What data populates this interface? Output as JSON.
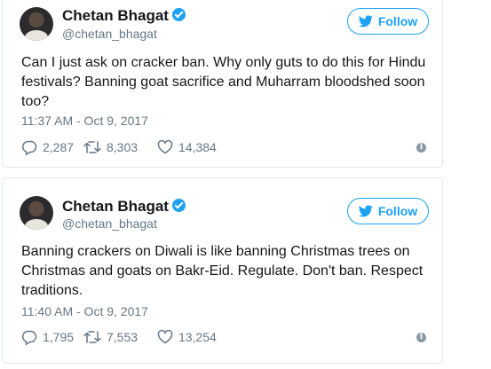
{
  "tweets": [
    {
      "author_name": "Chetan Bhagat",
      "handle": "@chetan_bhagat",
      "verified": true,
      "follow_label": "Follow",
      "text": "Can I just ask on cracker ban. Why only guts to do this for Hindu festivals? Banning goat sacrifice and Muharram bloodshed soon too?",
      "timestamp": "11:37 AM - Oct 9, 2017",
      "replies": "2,287",
      "retweets": "8,303",
      "likes": "14,384"
    },
    {
      "author_name": "Chetan Bhagat",
      "handle": "@chetan_bhagat",
      "verified": true,
      "follow_label": "Follow",
      "text": "Banning crackers on Diwali is like banning Christmas trees on Christmas and goats on Bakr-Eid. Regulate. Don't ban. Respect traditions.",
      "timestamp": "11:40 AM - Oct 9, 2017",
      "replies": "1,795",
      "retweets": "7,553",
      "likes": "13,254"
    }
  ],
  "colors": {
    "accent": "#1da1f2",
    "secondary_text": "#657786",
    "primary_text": "#14171a",
    "border": "#e1e8ed"
  },
  "icons": [
    "avatar",
    "verified-badge-icon",
    "twitter-bird-icon",
    "reply-icon",
    "retweet-icon",
    "like-icon",
    "info-icon"
  ]
}
